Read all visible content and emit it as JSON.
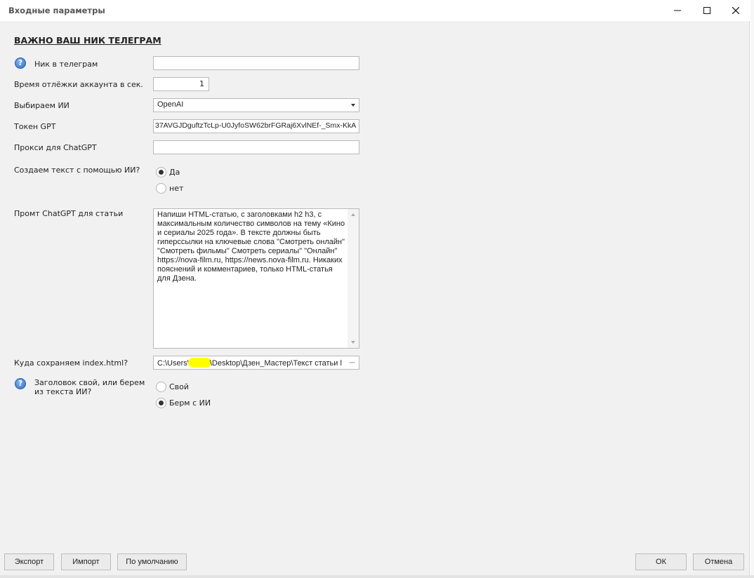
{
  "window": {
    "title": "Входные параметры"
  },
  "form": {
    "section_title": "ВАЖНО ВАШ НИК ТЕЛЕГРАМ",
    "telegram_nick": {
      "label": "Ник в телеграм",
      "value": ""
    },
    "sleep_time": {
      "label": "Время отлёжки аккаунта в сек.",
      "value": "1"
    },
    "ai_choice": {
      "label": "Выбираем ИИ",
      "value": "OpenAI"
    },
    "gpt_token": {
      "label": "Токен GPT",
      "value": "37AVGJDguftzTcLp-U0JyfoSW62brFGRaj6XvlNEf-_Smx-KkA"
    },
    "chatgpt_proxy": {
      "label": "Прокси для ChatGPT",
      "value": ""
    },
    "create_text_ai": {
      "label": "Создаем текст с помощью ИИ?",
      "options": [
        "Да",
        "нет"
      ],
      "selected": "Да"
    },
    "prompt": {
      "label": "Промт ChatGPT для статьи",
      "value": "Напиши HTML-статью, с заголовками h2 h3, с максимальным количество символов на тему «Кино и сериалы 2025 года». В тексте должны быть гиперссылки на ключевые слова \"Смотреть онлайн\" \"Смотреть фильмы\" Смотреть сериалы\" \"Онлайн\" https://nova-film.ru, https://news.nova-film.ru. Никаких пояснений и комментариев, только HTML-статья для Дзена."
    },
    "save_path": {
      "label": "Куда сохраняем index.html?",
      "value_start": "C:\\Users\\",
      "value_end": "\\Desktop\\Дзен_Мастер\\Текст статьи l",
      "browse_label": "···"
    },
    "heading_source": {
      "label": "Заголовок свой, или берем из текста ИИ?",
      "options": [
        "Свой",
        "Берм с ИИ"
      ],
      "selected": "Берм с ИИ"
    }
  },
  "footer": {
    "export": "Экспорт",
    "import": "Импорт",
    "default": "По умолчанию",
    "ok": "ОК",
    "cancel": "Отмена"
  }
}
